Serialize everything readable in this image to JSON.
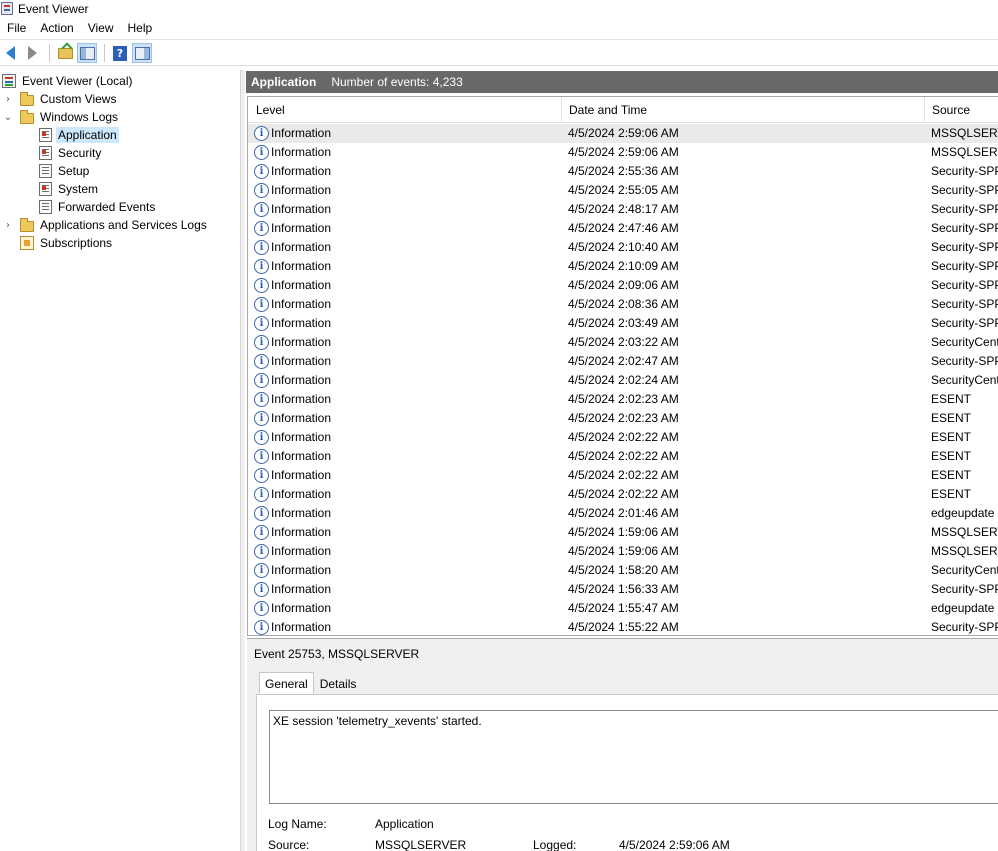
{
  "window": {
    "title": "Event Viewer"
  },
  "menu": [
    "File",
    "Action",
    "View",
    "Help"
  ],
  "toolbar": {
    "icons": [
      "back-icon",
      "forward-icon",
      "up-folder-icon",
      "show-hide-console-tree-icon",
      "help-icon",
      "show-hide-action-pane-icon"
    ]
  },
  "tree": {
    "root": "Event Viewer (Local)",
    "custom_views": "Custom Views",
    "windows_logs": "Windows Logs",
    "logs": [
      "Application",
      "Security",
      "Setup",
      "System",
      "Forwarded Events"
    ],
    "apps_services": "Applications and Services Logs",
    "subscriptions": "Subscriptions",
    "selected": "Application"
  },
  "header": {
    "log_name": "Application",
    "count_text": "Number of events: 4,233"
  },
  "columns": {
    "level": "Level",
    "date_time": "Date and Time",
    "source": "Source"
  },
  "events": [
    {
      "level": "Information",
      "date": "4/5/2024 2:59:06 AM",
      "source": "MSSQLSERVER"
    },
    {
      "level": "Information",
      "date": "4/5/2024 2:59:06 AM",
      "source": "MSSQLSERVER"
    },
    {
      "level": "Information",
      "date": "4/5/2024 2:55:36 AM",
      "source": "Security-SPP"
    },
    {
      "level": "Information",
      "date": "4/5/2024 2:55:05 AM",
      "source": "Security-SPP"
    },
    {
      "level": "Information",
      "date": "4/5/2024 2:48:17 AM",
      "source": "Security-SPP"
    },
    {
      "level": "Information",
      "date": "4/5/2024 2:47:46 AM",
      "source": "Security-SPP"
    },
    {
      "level": "Information",
      "date": "4/5/2024 2:10:40 AM",
      "source": "Security-SPP"
    },
    {
      "level": "Information",
      "date": "4/5/2024 2:10:09 AM",
      "source": "Security-SPP"
    },
    {
      "level": "Information",
      "date": "4/5/2024 2:09:06 AM",
      "source": "Security-SPP"
    },
    {
      "level": "Information",
      "date": "4/5/2024 2:08:36 AM",
      "source": "Security-SPP"
    },
    {
      "level": "Information",
      "date": "4/5/2024 2:03:49 AM",
      "source": "Security-SPP"
    },
    {
      "level": "Information",
      "date": "4/5/2024 2:03:22 AM",
      "source": "SecurityCenter"
    },
    {
      "level": "Information",
      "date": "4/5/2024 2:02:47 AM",
      "source": "Security-SPP"
    },
    {
      "level": "Information",
      "date": "4/5/2024 2:02:24 AM",
      "source": "SecurityCenter"
    },
    {
      "level": "Information",
      "date": "4/5/2024 2:02:23 AM",
      "source": "ESENT"
    },
    {
      "level": "Information",
      "date": "4/5/2024 2:02:23 AM",
      "source": "ESENT"
    },
    {
      "level": "Information",
      "date": "4/5/2024 2:02:22 AM",
      "source": "ESENT"
    },
    {
      "level": "Information",
      "date": "4/5/2024 2:02:22 AM",
      "source": "ESENT"
    },
    {
      "level": "Information",
      "date": "4/5/2024 2:02:22 AM",
      "source": "ESENT"
    },
    {
      "level": "Information",
      "date": "4/5/2024 2:02:22 AM",
      "source": "ESENT"
    },
    {
      "level": "Information",
      "date": "4/5/2024 2:01:46 AM",
      "source": "edgeupdate"
    },
    {
      "level": "Information",
      "date": "4/5/2024 1:59:06 AM",
      "source": "MSSQLSERVER"
    },
    {
      "level": "Information",
      "date": "4/5/2024 1:59:06 AM",
      "source": "MSSQLSERVER"
    },
    {
      "level": "Information",
      "date": "4/5/2024 1:58:20 AM",
      "source": "SecurityCenter"
    },
    {
      "level": "Information",
      "date": "4/5/2024 1:56:33 AM",
      "source": "Security-SPP"
    },
    {
      "level": "Information",
      "date": "4/5/2024 1:55:47 AM",
      "source": "edgeupdate"
    },
    {
      "level": "Information",
      "date": "4/5/2024 1:55:22 AM",
      "source": "Security-SPP"
    }
  ],
  "detail": {
    "title": "Event 25753, MSSQLSERVER",
    "tabs": [
      "General",
      "Details"
    ],
    "active_tab": "General",
    "message": "XE session 'telemetry_xevents' started.",
    "log_name_label": "Log Name:",
    "log_name_value": "Application",
    "source_label": "Source:",
    "source_value": "MSSQLSERVER",
    "logged_label": "Logged:",
    "logged_value": "4/5/2024 2:59:06 AM"
  },
  "colors": {
    "header_bg": "#686868",
    "selection": "#cce8ff",
    "info_icon": "#2b5fb8"
  }
}
